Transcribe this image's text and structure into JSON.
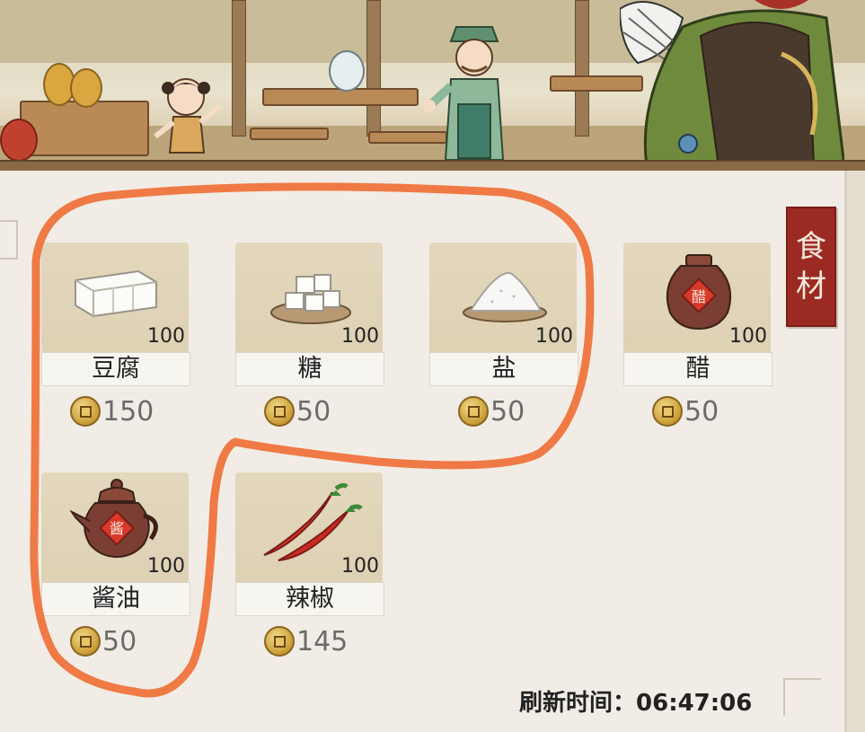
{
  "category_tab": {
    "label_1": "食",
    "label_2": "材",
    "color": "#9b2b22"
  },
  "items": [
    {
      "name": "豆腐",
      "count": "100",
      "price": "150",
      "icon": "tofu-icon"
    },
    {
      "name": "糖",
      "count": "100",
      "price": "50",
      "icon": "sugar-icon"
    },
    {
      "name": "盐",
      "count": "100",
      "price": "50",
      "icon": "salt-icon"
    },
    {
      "name": "醋",
      "count": "100",
      "price": "50",
      "icon": "vinegar-jar-icon",
      "jar_label": "醋"
    },
    {
      "name": "酱油",
      "count": "100",
      "price": "50",
      "icon": "soy-sauce-pot-icon",
      "jar_label": "酱"
    },
    {
      "name": "辣椒",
      "count": "100",
      "price": "145",
      "icon": "chili-pepper-icon"
    }
  ],
  "refresh": {
    "label": "刷新时间：",
    "time": "06:47:06"
  },
  "annotation_color": "#f07a45"
}
